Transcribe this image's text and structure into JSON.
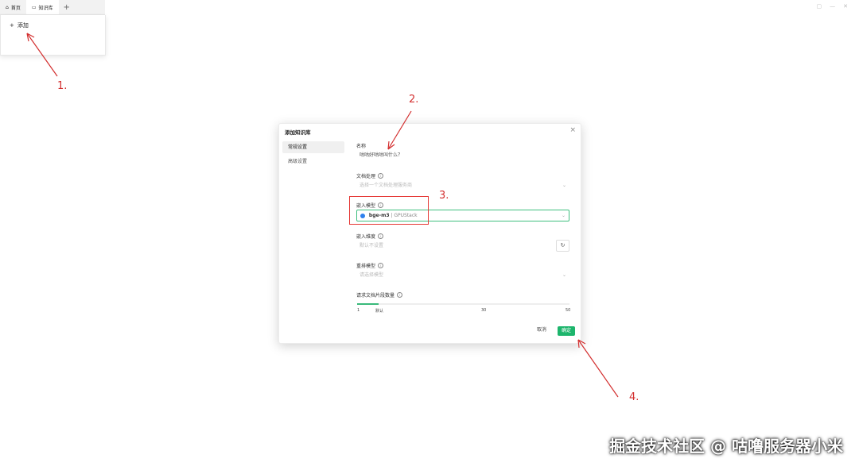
{
  "tabs": [
    {
      "label": "首页",
      "icon": "home-icon"
    },
    {
      "label": "知识库",
      "icon": "document-icon"
    }
  ],
  "panel": {
    "add_label": "添加"
  },
  "dialog": {
    "title": "添加知识库",
    "sidebar": [
      "常规设置",
      "高级设置"
    ],
    "name_label": "名称",
    "name_value": "咕咕好咕咕叫什么？",
    "doc_processing_label": "文档处理",
    "doc_processing_placeholder": "选择一个文档处理服务商",
    "embed_model_label": "嵌入模型",
    "embed_model_name": "bge-m3",
    "embed_model_provider": "| GPUStack",
    "embed_dim_label": "嵌入维度",
    "embed_dim_placeholder": "默认不设置",
    "rerank_label": "重排模型",
    "rerank_placeholder": "请选择模型",
    "docs_count_label": "请求文档片段数量",
    "slider": {
      "value": 6,
      "min": 1,
      "max": 50,
      "min_label": "1",
      "default_label": "默认",
      "mid_label": "30",
      "max_label": "50"
    },
    "cancel": "取消",
    "ok": "确定"
  },
  "annotations": [
    "1.",
    "2.",
    "3.",
    "4."
  ],
  "watermark": "掘金技术社区 @ 咕噜服务器小米",
  "colors": {
    "accent": "#1db56c",
    "annotation": "#d32f2f"
  }
}
